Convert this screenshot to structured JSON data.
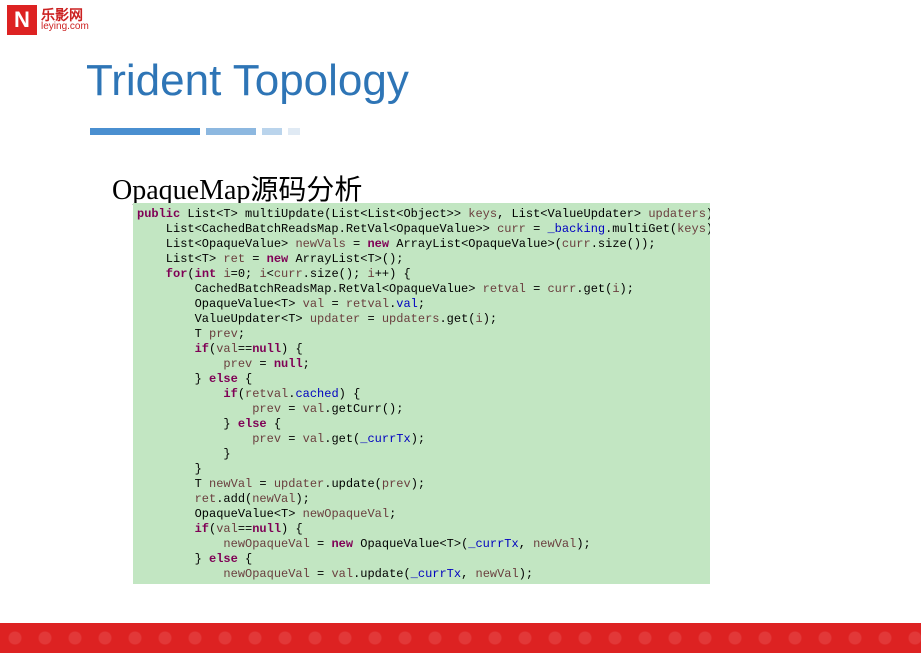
{
  "logo": {
    "symbol": "N",
    "cn": "乐影网",
    "en": "leying.com"
  },
  "title": "Trident Topology",
  "subtitle_en": "OpaqueMap",
  "subtitle_cn": "源码分析",
  "code": {
    "l1a": "public",
    "l1b": " List<T> multiUpdate(List<List<Object>> ",
    "l1c": "keys",
    "l1d": ", List<ValueUpdater> ",
    "l1e": "updaters",
    "l1f": ") {",
    "l2a": "    List<CachedBatchReadsMap.RetVal<OpaqueValue>> ",
    "l2b": "curr",
    "l2c": " = ",
    "l2d": "_backing",
    "l2e": ".multiGet(",
    "l2f": "keys",
    "l2g": ");",
    "l3a": "    List<OpaqueValue> ",
    "l3b": "newVals",
    "l3c": " = ",
    "l3d": "new",
    "l3e": " ArrayList<OpaqueValue>(",
    "l3f": "curr",
    "l3g": ".size());",
    "l4a": "    List<T> ",
    "l4b": "ret",
    "l4c": " = ",
    "l4d": "new",
    "l4e": " ArrayList<T>();",
    "l5a": "    for",
    "l5b": "(",
    "l5c": "int",
    "l5d": " ",
    "l5e": "i",
    "l5f": "=0; ",
    "l5g": "i",
    "l5h": "<",
    "l5i": "curr",
    "l5j": ".size(); ",
    "l5k": "i",
    "l5l": "++) {",
    "l6a": "        CachedBatchReadsMap.RetVal<OpaqueValue> ",
    "l6b": "retval",
    "l6c": " = ",
    "l6d": "curr",
    "l6e": ".get(",
    "l6f": "i",
    "l6g": ");",
    "l7a": "        OpaqueValue<T> ",
    "l7b": "val",
    "l7c": " = ",
    "l7d": "retval",
    "l7e": ".",
    "l7f": "val",
    "l7g": ";",
    "l8a": "        ValueUpdater<T> ",
    "l8b": "updater",
    "l8c": " = ",
    "l8d": "updaters",
    "l8e": ".get(",
    "l8f": "i",
    "l8g": ");",
    "l9a": "        T ",
    "l9b": "prev",
    "l9c": ";",
    "l10a": "        if",
    "l10b": "(",
    "l10c": "val",
    "l10d": "==",
    "l10e": "null",
    "l10f": ") {",
    "l11a": "            ",
    "l11b": "prev",
    "l11c": " = ",
    "l11d": "null",
    "l11e": ";",
    "l12a": "        } ",
    "l12b": "else",
    "l12c": " {",
    "l13a": "            if",
    "l13b": "(",
    "l13c": "retval",
    "l13d": ".",
    "l13e": "cached",
    "l13f": ") {",
    "l14a": "                ",
    "l14b": "prev",
    "l14c": " = ",
    "l14d": "val",
    "l14e": ".getCurr();",
    "l15a": "            } ",
    "l15b": "else",
    "l15c": " {",
    "l16a": "                ",
    "l16b": "prev",
    "l16c": " = ",
    "l16d": "val",
    "l16e": ".get(",
    "l16f": "_currTx",
    "l16g": ");",
    "l17": "            }",
    "l18": "        }",
    "l19a": "        T ",
    "l19b": "newVal",
    "l19c": " = ",
    "l19d": "updater",
    "l19e": ".update(",
    "l19f": "prev",
    "l19g": ");",
    "l20a": "        ",
    "l20b": "ret",
    "l20c": ".add(",
    "l20d": "newVal",
    "l20e": ");",
    "l21a": "        OpaqueValue<T> ",
    "l21b": "newOpaqueVal",
    "l21c": ";",
    "l22a": "        if",
    "l22b": "(",
    "l22c": "val",
    "l22d": "==",
    "l22e": "null",
    "l22f": ") {",
    "l23a": "            ",
    "l23b": "newOpaqueVal",
    "l23c": " = ",
    "l23d": "new",
    "l23e": " OpaqueValue<T>(",
    "l23f": "_currTx",
    "l23g": ", ",
    "l23h": "newVal",
    "l23i": ");",
    "l24a": "        } ",
    "l24b": "else",
    "l24c": " {",
    "l25a": "            ",
    "l25b": "newOpaqueVal",
    "l25c": " = ",
    "l25d": "val",
    "l25e": ".update(",
    "l25f": "_currTx",
    "l25g": ", ",
    "l25h": "newVal",
    "l25i": ");"
  }
}
